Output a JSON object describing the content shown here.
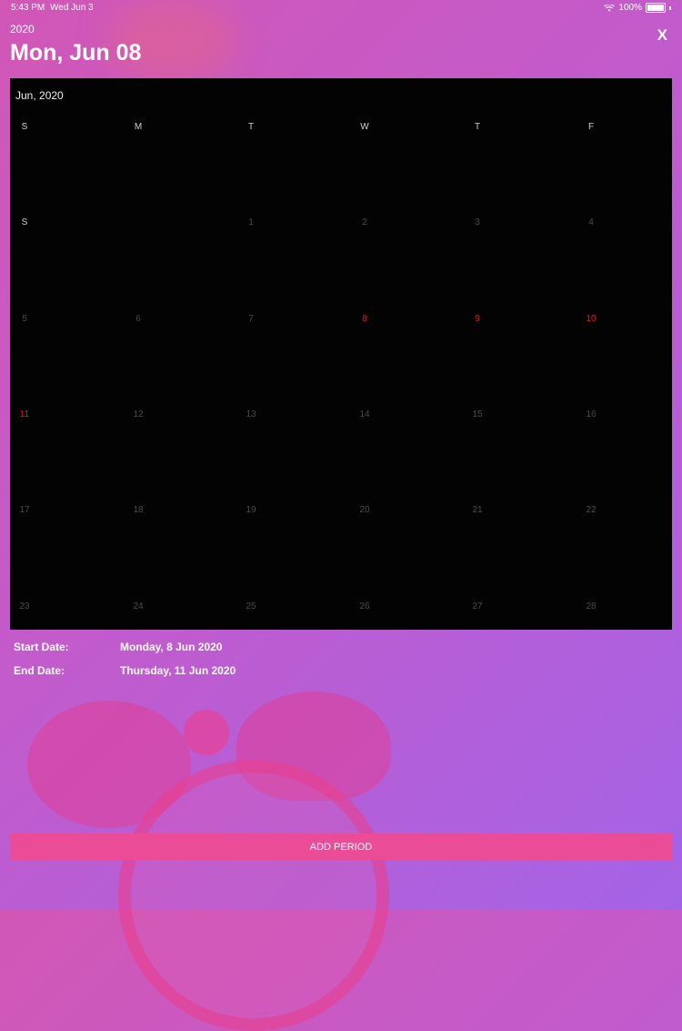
{
  "status_bar": {
    "time": "5:43 PM",
    "date": "Wed Jun 3",
    "battery": "100%"
  },
  "header": {
    "year": "2020",
    "title": "Mon, Jun 08",
    "close_label": "X"
  },
  "calendar": {
    "month_label": "Jun, 2020",
    "weekday_headers": [
      "S",
      "M",
      "T",
      "W",
      "T",
      "F"
    ],
    "rows": [
      [
        {
          "d": "S",
          "k": "sat"
        },
        {
          "d": ""
        },
        {
          "d": "1"
        },
        {
          "d": "2"
        },
        {
          "d": "3"
        },
        {
          "d": "4"
        }
      ],
      [
        {
          "d": "5"
        },
        {
          "d": "6"
        },
        {
          "d": "7"
        },
        {
          "d": "8",
          "k": "sel"
        },
        {
          "d": "9",
          "k": "sel"
        },
        {
          "d": "10",
          "k": "sel"
        }
      ],
      [
        {
          "d": "11",
          "k": "sel"
        },
        {
          "d": "12"
        },
        {
          "d": "13"
        },
        {
          "d": "14"
        },
        {
          "d": "15"
        },
        {
          "d": "16"
        }
      ],
      [
        {
          "d": "17"
        },
        {
          "d": "18"
        },
        {
          "d": "19"
        },
        {
          "d": "20"
        },
        {
          "d": "21"
        },
        {
          "d": "22"
        }
      ],
      [
        {
          "d": "23"
        },
        {
          "d": "24"
        },
        {
          "d": "25"
        },
        {
          "d": "26"
        },
        {
          "d": "27"
        },
        {
          "d": "28"
        }
      ]
    ]
  },
  "period": {
    "start_label": "Start Date:",
    "start_value": "Monday, 8 Jun 2020",
    "end_label": "End Date:",
    "end_value": "Thursday, 11 Jun 2020"
  },
  "actions": {
    "add_period_label": "ADD PERIOD"
  },
  "colors": {
    "accent": "#ea4c97",
    "selected_day": "#e01a1a",
    "calendar_bg": "#030304"
  }
}
